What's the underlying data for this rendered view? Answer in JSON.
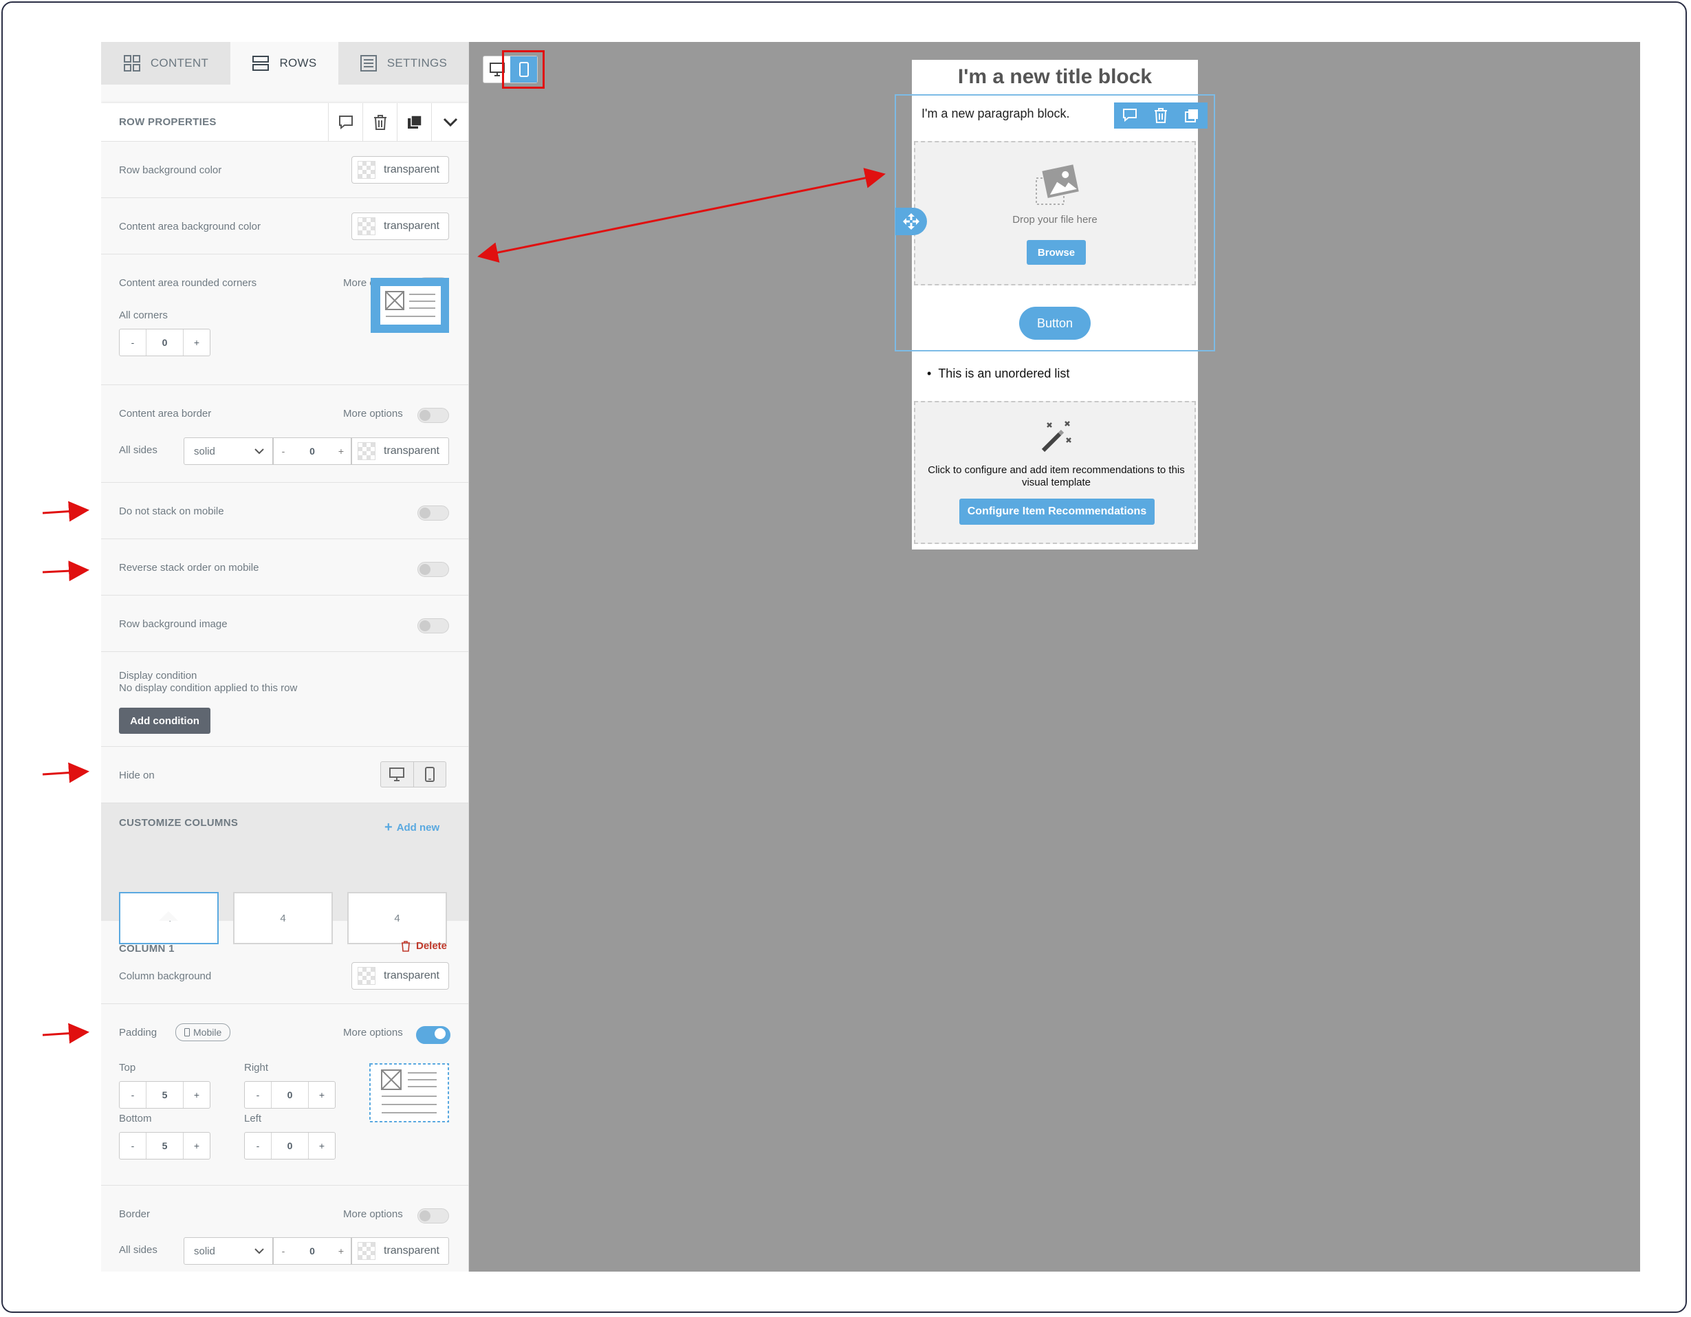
{
  "tabs": [
    {
      "label": "CONTENT",
      "icon": "grid-icon"
    },
    {
      "label": "ROWS",
      "icon": "rows-icon"
    },
    {
      "label": "SETTINGS",
      "icon": "settings-icon"
    }
  ],
  "row_properties": {
    "title": "ROW PROPERTIES",
    "row_bg_label": "Row background color",
    "row_bg_value": "transparent",
    "content_bg_label": "Content area background color",
    "content_bg_value": "transparent",
    "rounded_label": "Content area rounded corners",
    "rounded_more": "More options",
    "all_corners_label": "All corners",
    "all_corners_minus": "-",
    "all_corners_value": "0",
    "all_corners_plus": "+",
    "border_label": "Content area border",
    "border_more": "More options",
    "all_sides_label": "All sides",
    "border_style": "solid",
    "border_width_minus": "-",
    "border_width": "0",
    "border_width_plus": "+",
    "border_color": "transparent",
    "no_stack_label": "Do not stack on mobile",
    "reverse_stack_label": "Reverse stack order on mobile",
    "row_bg_image_label": "Row background image",
    "display_condition_label": "Display condition",
    "display_condition_desc": "No display condition applied to this row",
    "add_condition": "Add condition",
    "hide_on_label": "Hide on"
  },
  "columns": {
    "title": "CUSTOMIZE COLUMNS",
    "add_new": "Add new",
    "cards": [
      "4",
      "4",
      "4"
    ]
  },
  "column1": {
    "title": "COLUMN 1",
    "delete": "Delete",
    "bg_label": "Column background",
    "bg_value": "transparent",
    "padding_label": "Padding",
    "padding_badge": "Mobile",
    "padding_more": "More options",
    "top_label": "Top",
    "top_minus": "-",
    "top_value": "5",
    "top_plus": "+",
    "right_label": "Right",
    "right_minus": "-",
    "right_value": "0",
    "right_plus": "+",
    "bottom_label": "Bottom",
    "bottom_minus": "-",
    "bottom_value": "5",
    "bottom_plus": "+",
    "left_label": "Left",
    "left_minus": "-",
    "left_value": "0",
    "left_plus": "+",
    "border_label": "Border",
    "border_more": "More options",
    "all_sides_label": "All sides",
    "border_style": "solid",
    "border_width_minus": "-",
    "border_width": "0",
    "border_width_plus": "+",
    "border_color": "transparent"
  },
  "email": {
    "title": "I'm a new title block",
    "paragraph": "I'm a new paragraph block.",
    "drop_text": "Drop your file here",
    "browse": "Browse",
    "button": "Button",
    "list_item": "This is an unordered list",
    "reco_text": "Click to configure and add item recommendations to this visual template",
    "reco_button": "Configure Item Recommendations"
  },
  "colors": {
    "accent": "#5aa9e0",
    "panel_bg": "#f8f8f8",
    "canvas_bg": "#999999",
    "annotation": "#e01010",
    "delete": "#c0392b"
  }
}
